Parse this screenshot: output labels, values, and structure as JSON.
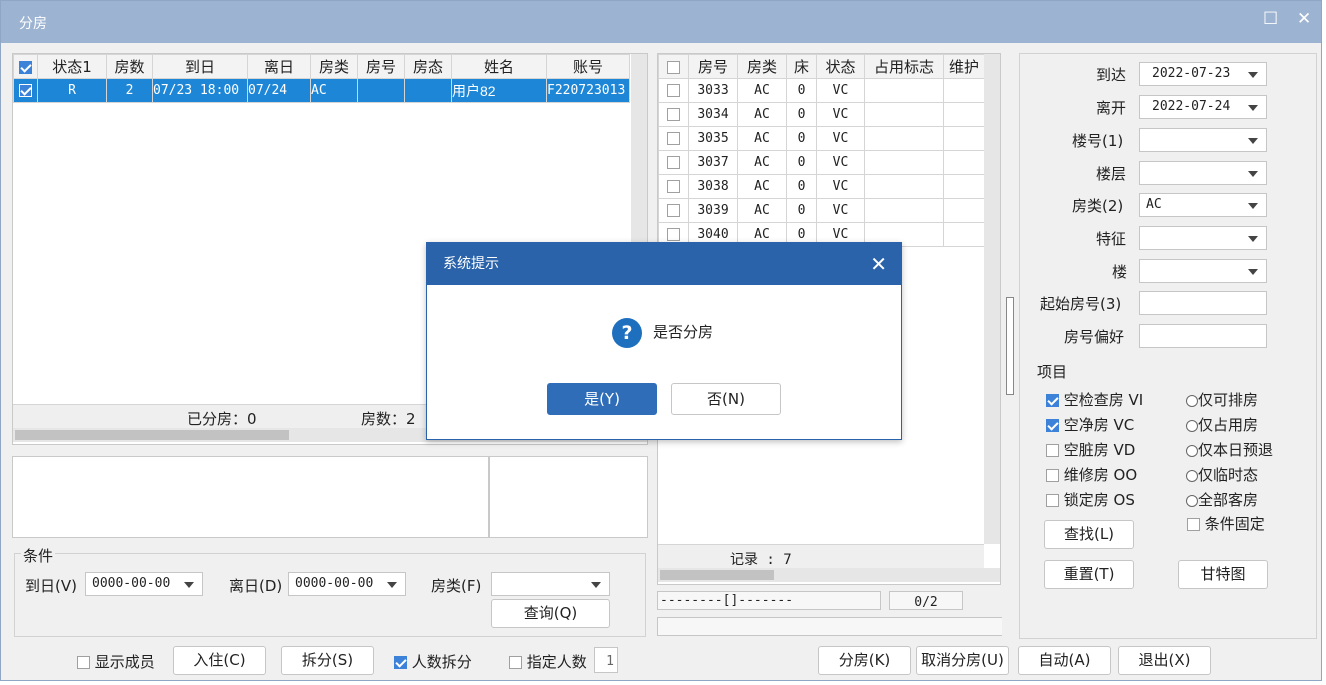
{
  "window": {
    "title": "分房",
    "max_icon": "maximize-icon",
    "close_icon": "close-icon"
  },
  "left_table": {
    "headers": [
      "状态1",
      "房数",
      "到日",
      "离日",
      "房类",
      "房号",
      "房态",
      "姓名",
      "账号"
    ],
    "rows": [
      {
        "status": "R",
        "count": "2",
        "arrive": "07/23 18:00",
        "depart": "07/24",
        "type": "AC",
        "room": "",
        "roomstatus": "",
        "name": "用户82",
        "account": "F220723013"
      }
    ],
    "footer_assigned": "已分房：0",
    "footer_rooms": "房数：2"
  },
  "conditions": {
    "title": "条件",
    "arrive_label": "到日(V)",
    "arrive_value": "0000-00-00",
    "depart_label": "离日(D)",
    "depart_value": "0000-00-00",
    "type_label": "房类(F)",
    "type_value": "",
    "query_button": "查询(Q)"
  },
  "room_table": {
    "headers": [
      "房号",
      "房类",
      "床",
      "状态",
      "占用标志",
      "维护"
    ],
    "rows": [
      {
        "room": "3033",
        "type": "AC",
        "bed": "0",
        "status": "VC",
        "occ": "",
        "maint": ""
      },
      {
        "room": "3034",
        "type": "AC",
        "bed": "0",
        "status": "VC",
        "occ": "",
        "maint": ""
      },
      {
        "room": "3035",
        "type": "AC",
        "bed": "0",
        "status": "VC",
        "occ": "",
        "maint": ""
      },
      {
        "room": "3037",
        "type": "AC",
        "bed": "0",
        "status": "VC",
        "occ": "",
        "maint": ""
      },
      {
        "room": "3038",
        "type": "AC",
        "bed": "0",
        "status": "VC",
        "occ": "",
        "maint": ""
      },
      {
        "room": "3039",
        "type": "AC",
        "bed": "0",
        "status": "VC",
        "occ": "",
        "maint": ""
      },
      {
        "room": "3040",
        "type": "AC",
        "bed": "0",
        "status": "VC",
        "occ": "",
        "maint": ""
      }
    ],
    "record_count": "记录 : 7",
    "progress_text": "--------[]-------",
    "progress_count": "0/2"
  },
  "filters": {
    "arrive_label": "到达",
    "arrive_value": "2022-07-23",
    "leave_label": "离开",
    "leave_value": "2022-07-24",
    "building_label": "楼号(1)",
    "floor_label": "楼层",
    "roomtype_label": "房类(2)",
    "roomtype_value": "AC",
    "feature_label": "特征",
    "block_label": "楼",
    "start_room_label": "起始房号(3)",
    "pref_label": "房号偏好",
    "items_title": "项目",
    "checks": [
      {
        "label": "空检查房 VI",
        "checked": true
      },
      {
        "label": "空净房 VC",
        "checked": true
      },
      {
        "label": "空脏房 VD",
        "checked": false
      },
      {
        "label": "维修房 OO",
        "checked": false
      },
      {
        "label": "锁定房 OS",
        "checked": false
      }
    ],
    "radios": [
      "仅可排房",
      "仅占用房",
      "仅本日预退",
      "仅临时态",
      "全部客房"
    ],
    "fixed_label": "条件固定",
    "find_button": "查找(L)",
    "reset_button": "重置(T)",
    "gantt_button": "甘特图"
  },
  "bottom": {
    "show_members": "显示成员",
    "checkin_button": "入住(C)",
    "split_button": "拆分(S)",
    "split_by_people": "人数拆分",
    "specify_people": "指定人数",
    "people_value": "1",
    "assign_button": "分房(K)",
    "cancel_assign_button": "取消分房(U)",
    "auto_button": "自动(A)",
    "exit_button": "退出(X)"
  },
  "dialog": {
    "title": "系统提示",
    "message": "是否分房",
    "yes_button": "是(Y)",
    "no_button": "否(N)"
  }
}
